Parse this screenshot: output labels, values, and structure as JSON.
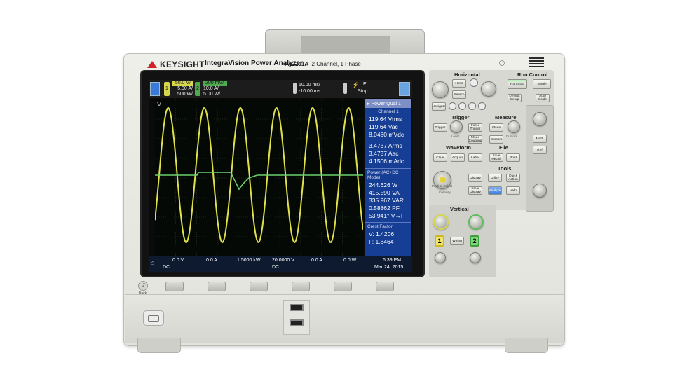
{
  "device": {
    "brand": "KEYSIGHT",
    "product_name": "IntegraVision Power Analyzer",
    "model": "PA2201A",
    "model_detail": "2 Channel, 1 Phase"
  },
  "screen": {
    "topbar": {
      "ch1_volts": "50.0 V/",
      "ch1_amps": "5.00 A/",
      "ch1_watts": "500 W/",
      "ch2_volts": "200 mV/",
      "ch2_amps": "10.0 A/",
      "ch2_watts": "5.00 W/",
      "timebase": "10.00 ms/",
      "delay": "-10.00 ms",
      "trigger_mode": "E",
      "run_state": "Stop"
    },
    "plot_label": "V",
    "side_panel": {
      "title": "Power Qual 1",
      "channel_label": "Channel 1",
      "vrms": "119.64 Vrms",
      "vac": "119.64 Vac",
      "vdc": "8.0460 mVdc",
      "arms": "3.4737 Arms",
      "aac": "3.4737 Aac",
      "adc": "4.1506 mAdc",
      "power_label": "Power (AC+DC Mode)",
      "w": "244.626 W",
      "va": "415.590 VA",
      "var": "335.967 VAR",
      "pf": "0.58862 PF",
      "phase": "53.941° V→I",
      "crest_label": "Crest Factor",
      "crest_v": "V:  1.4206",
      "crest_i": "I :  1.8464"
    },
    "bottombar": {
      "v_offset": "0.0 V",
      "a_offset": "0.0 A",
      "w_scale": "1.5000 kW",
      "v2": "20.0000 V",
      "a2": "0.0 A",
      "w2": "0.0 W",
      "coupling1": "DC",
      "coupling2": "DC",
      "time": "6:39 PM",
      "date": "Mar 24, 2015"
    }
  },
  "panel": {
    "horizontal": "Horizontal",
    "run_control": "Run Control",
    "horiz_btn": "Horiz",
    "search_btn": "Search",
    "navigate_btn": "Navigate",
    "run_stop_btn": "Run Stop",
    "single_btn": "Single",
    "default_setup_btn": "Default Setup",
    "auto_scale_btn": "Auto Scale",
    "trigger": "Trigger",
    "measure": "Measure",
    "trigger_btn": "Trigger",
    "force_trigger_btn": "Force Trigger",
    "mode_coupling_btn": "Mode Coupling",
    "meas_btn": "Meas",
    "cursors_btn": "Cursors",
    "cursors_label": "Cursors",
    "level_label": "Level",
    "math_btn": "Math",
    "ref_btn": "Ref",
    "waveform": "Waveform",
    "file": "File",
    "clear_btn": "Clear",
    "acquire_btn": "Acquire",
    "label_btn": "Label",
    "save_recall_btn": "Save Recall",
    "print_btn": "Print",
    "tools": "Tools",
    "display_btn": "Display",
    "utility_btn": "Utility",
    "quick_action_btn": "Quick Action",
    "clear_display_btn": "Clear Display",
    "analyze_btn": "Analyze",
    "help_btn": "Help",
    "intensity_label": "Intensity",
    "push_select": "Push to Select",
    "vertical": "Vertical",
    "wiring_btn": "Wiring",
    "ch1_btn": "1",
    "ch2_btn": "2",
    "back_label": "Back"
  },
  "colors": {
    "ch1": "#e0e14a",
    "ch2": "#6bd26b",
    "side_panel": "#153e94",
    "analyze": "#3f7fd9"
  }
}
